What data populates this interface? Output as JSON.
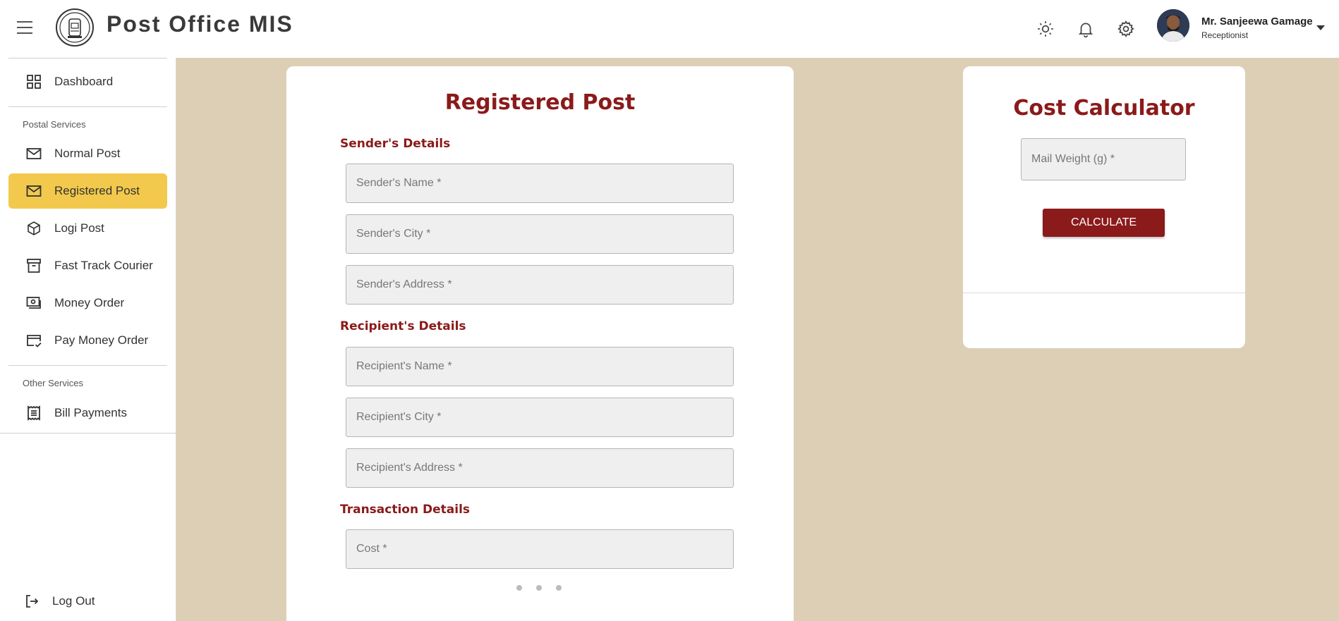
{
  "header": {
    "app_title": "Post Office MIS",
    "user": {
      "name": "Mr. Sanjeewa Gamage",
      "role": "Receptionist"
    },
    "icons": [
      "menu-icon",
      "sun-icon",
      "bell-icon",
      "gear-icon",
      "chevron-down-icon"
    ]
  },
  "sidebar": {
    "dashboard": "Dashboard",
    "postal_services_label": "Postal Services",
    "postal_items": [
      {
        "label": "Normal Post",
        "icon": "mail-icon"
      },
      {
        "label": "Registered Post",
        "icon": "mail-icon",
        "active": true
      },
      {
        "label": "Logi Post",
        "icon": "package-icon"
      },
      {
        "label": "Fast Track Courier",
        "icon": "archive-box-icon"
      },
      {
        "label": "Money Order",
        "icon": "money-icon"
      },
      {
        "label": "Pay Money Order",
        "icon": "card-check-icon"
      }
    ],
    "other_services_label": "Other Services",
    "other_items": [
      {
        "label": "Bill Payments",
        "icon": "receipt-icon"
      }
    ],
    "logout": "Log Out"
  },
  "form": {
    "title": "Registered Post",
    "sender_section": "Sender's Details",
    "sender_fields": [
      "Sender's Name *",
      "Sender's City *",
      "Sender's Address *"
    ],
    "recipient_section": "Recipient's Details",
    "recipient_fields": [
      "Recipient's Name *",
      "Recipient's City *",
      "Recipient's Address *"
    ],
    "transaction_section": "Transaction Details",
    "transaction_fields": [
      "Cost *"
    ]
  },
  "calculator": {
    "title": "Cost Calculator",
    "weight_placeholder": "Mail Weight (g) *",
    "button_label": "CALCULATE"
  },
  "colors": {
    "accent": "#8b1a1a",
    "active_item": "#f2c94c",
    "background": "#ddcfb5"
  }
}
